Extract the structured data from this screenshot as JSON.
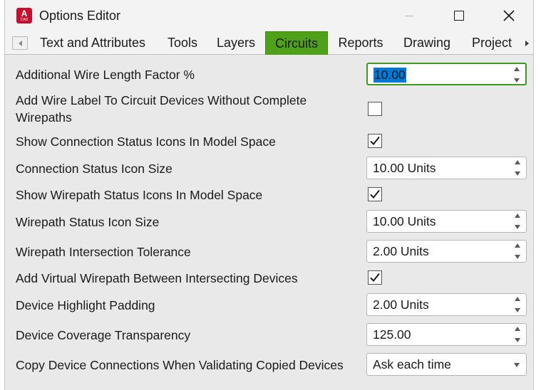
{
  "window": {
    "title": "Options Editor",
    "app_icon_letter": "A",
    "app_icon_sub": "CAD",
    "minimize_icon": "minimize-icon",
    "maximize_icon": "maximize-icon",
    "close_icon": "close-icon"
  },
  "tabs": [
    {
      "label": "Text and Attributes",
      "active": false
    },
    {
      "label": "Tools",
      "active": false
    },
    {
      "label": "Layers",
      "active": false
    },
    {
      "label": "Circuits",
      "active": true
    },
    {
      "label": "Reports",
      "active": false
    },
    {
      "label": "Drawing",
      "active": false
    },
    {
      "label": "Project",
      "active": false
    }
  ],
  "colors": {
    "active_tab": "#4fa11a",
    "focus_border": "#3a9c1e",
    "selection": "#0078d7",
    "app_icon": "#c8102e"
  },
  "options": [
    {
      "label": "Additional Wire Length Factor %",
      "control": "spin",
      "value": "10.00",
      "focused": true,
      "selected": true
    },
    {
      "label": "Add Wire Label To Circuit Devices Without Complete Wirepaths",
      "control": "checkbox",
      "checked": false
    },
    {
      "label": "Show Connection Status Icons In Model Space",
      "control": "checkbox",
      "checked": true
    },
    {
      "label": "Connection Status Icon Size",
      "control": "spin",
      "value": "10.00 Units"
    },
    {
      "label": "Show Wirepath Status Icons In Model Space",
      "control": "checkbox",
      "checked": true
    },
    {
      "label": "Wirepath Status Icon Size",
      "control": "spin",
      "value": "10.00 Units"
    },
    {
      "label": "Wirepath Intersection Tolerance",
      "control": "spin",
      "value": "2.00 Units"
    },
    {
      "label": "Add Virtual Wirepath Between Intersecting Devices",
      "control": "checkbox",
      "checked": true
    },
    {
      "label": "Device Highlight Padding",
      "control": "spin",
      "value": "2.00 Units"
    },
    {
      "label": "Device Coverage Transparency",
      "control": "spin",
      "value": "125.00"
    },
    {
      "label": "Copy Device Connections When Validating Copied Devices",
      "control": "dropdown",
      "value": "Ask each time"
    }
  ]
}
